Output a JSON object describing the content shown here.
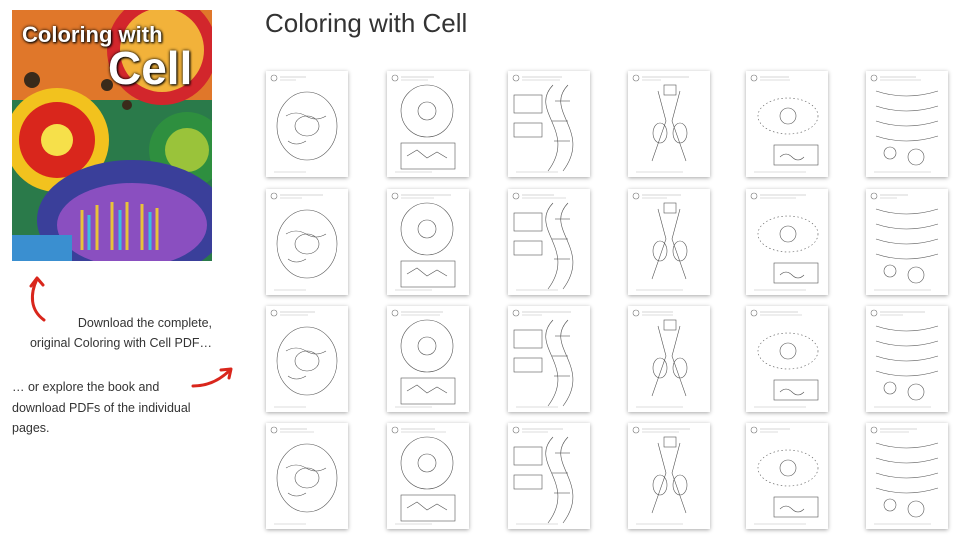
{
  "page": {
    "title": "Coloring with Cell"
  },
  "cover": {
    "title_line1": "Coloring with",
    "title_line2": "Cell"
  },
  "download": {
    "line1": "Download the complete,",
    "line2": "original Coloring with Cell PDF…"
  },
  "explore": {
    "line1": "… or explore the book and",
    "line2": "download PDFs of the individual",
    "line3": "pages."
  },
  "accent_color": "#d9261c",
  "thumbnails": {
    "rows": 4,
    "columns": 6,
    "count": 24
  }
}
